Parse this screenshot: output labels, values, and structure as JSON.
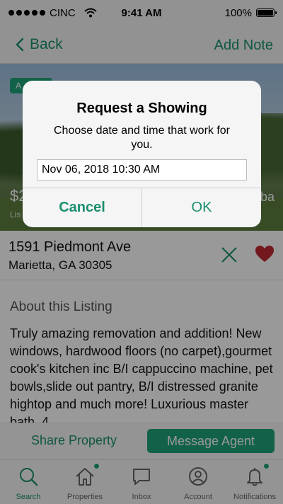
{
  "status_bar": {
    "carrier": "CINC",
    "time": "9:41 AM",
    "battery": "100%"
  },
  "nav": {
    "back_label": "Back",
    "add_note_label": "Add Note"
  },
  "hero": {
    "badge": "A",
    "price": "$2",
    "sub": "Lis",
    "ba": "ba"
  },
  "listing": {
    "street": "1591 Piedmont Ave",
    "city": "Marietta, GA 30305"
  },
  "about": {
    "title": "About this Listing",
    "text": "Truly amazing removation and addition! New windows, hardwood floors (no carpet),gourmet cook's kitchen inc B/I cappuccino machine, pet bowls,slide out pantry, B/I distressed granite hightop and much more! Luxurious master bath, 4"
  },
  "actions": {
    "share_label": "Share Property",
    "message_label": "Message Agent"
  },
  "tabs": [
    {
      "label": "Search",
      "icon": "search-icon"
    },
    {
      "label": "Properties",
      "icon": "home-icon"
    },
    {
      "label": "Inbox",
      "icon": "chat-icon"
    },
    {
      "label": "Account",
      "icon": "user-icon"
    },
    {
      "label": "Notifications",
      "icon": "bell-icon"
    }
  ],
  "dialog": {
    "title": "Request a Showing",
    "message": "Choose date and time that work for you.",
    "datetime_value": "Nov 06, 2018 10:30 AM",
    "cancel_label": "Cancel",
    "ok_label": "OK"
  },
  "colors": {
    "accent": "#1fa37a",
    "accent_text": "#1a8f6e",
    "heart": "#c0282f"
  }
}
